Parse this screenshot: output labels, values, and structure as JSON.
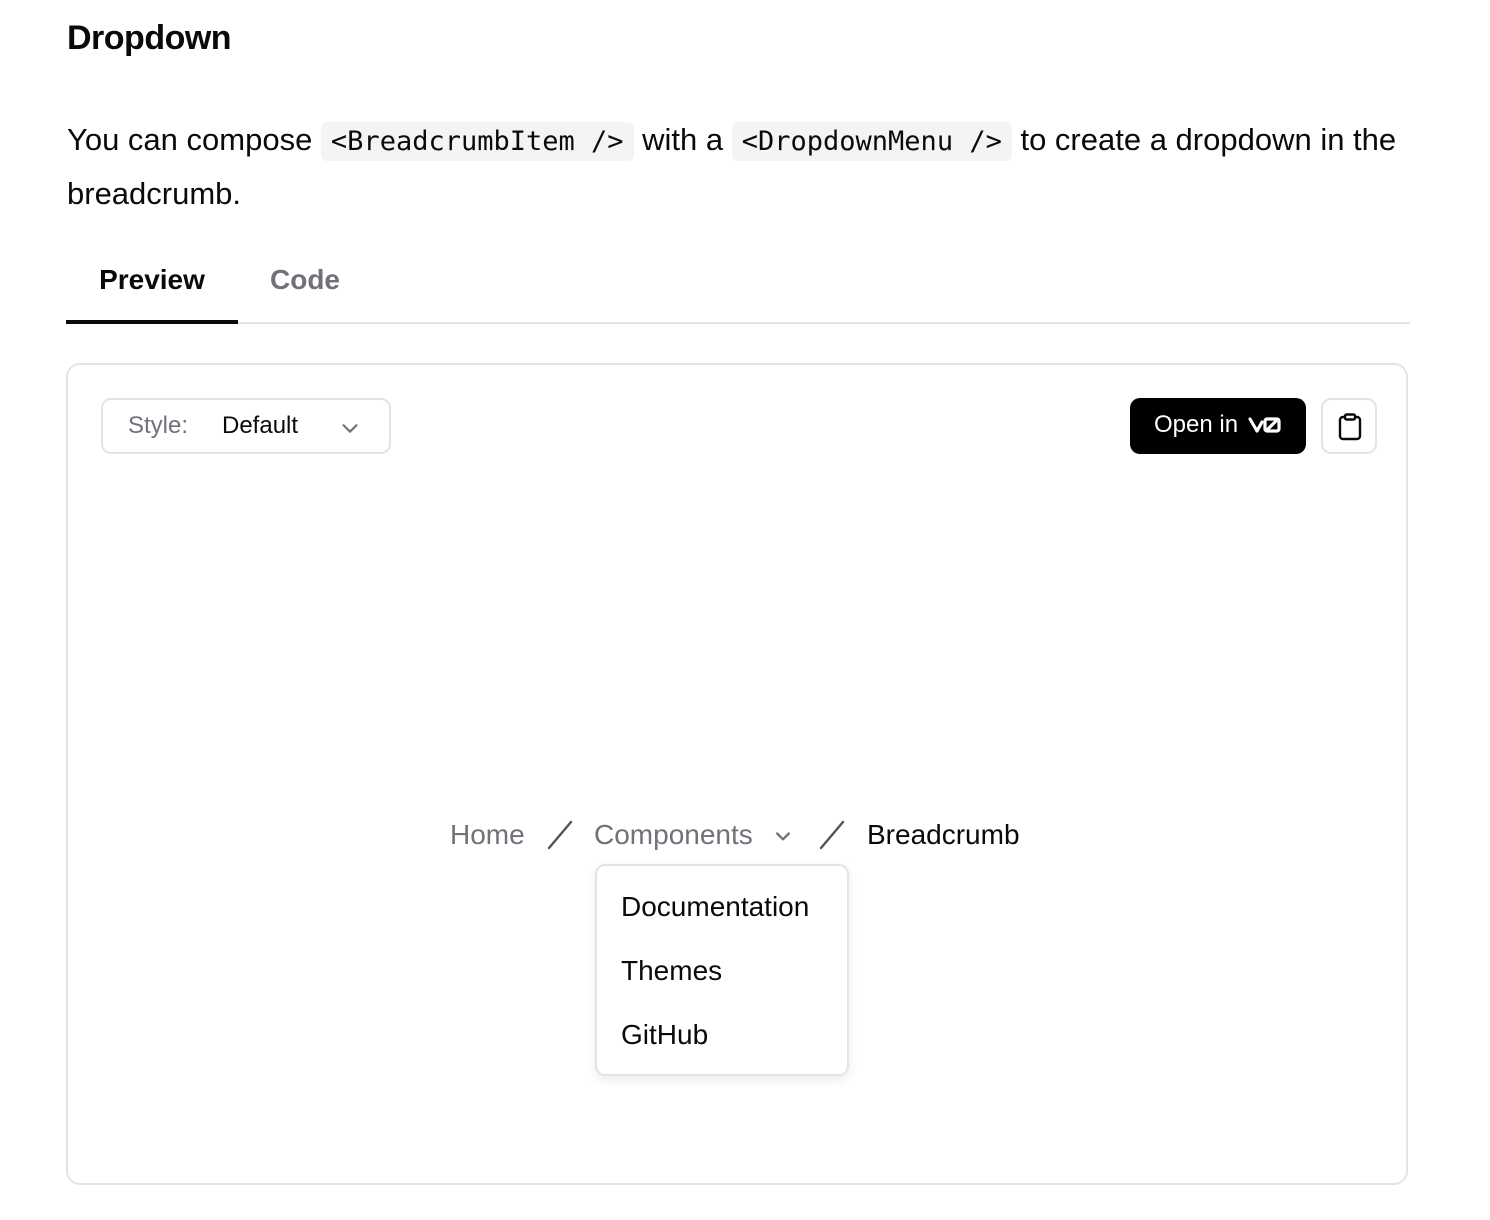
{
  "section": {
    "title": "Dropdown",
    "description": {
      "part1": "You can compose ",
      "code1": "<BreadcrumbItem />",
      "part2": " with a ",
      "code2": "<DropdownMenu />",
      "part3": " to create a dropdown in the breadcrumb."
    }
  },
  "tabs": [
    {
      "label": "Preview",
      "active": true
    },
    {
      "label": "Code",
      "active": false
    }
  ],
  "toolbar": {
    "style_label": "Style:",
    "style_value": "Default",
    "open_label": "Open in",
    "open_icon": "v0-logo-icon",
    "copy_icon": "clipboard-icon"
  },
  "breadcrumb": {
    "items": [
      {
        "label": "Home"
      },
      {
        "label": "Components"
      },
      {
        "label": "Breadcrumb"
      }
    ]
  },
  "dropdown": {
    "items": [
      "Documentation",
      "Themes",
      "GitHub"
    ]
  },
  "colors": {
    "text": "#0a0a0a",
    "muted": "#71717a",
    "border": "#e4e4e7",
    "code_bg": "#f4f4f5",
    "button_bg": "#000000"
  }
}
